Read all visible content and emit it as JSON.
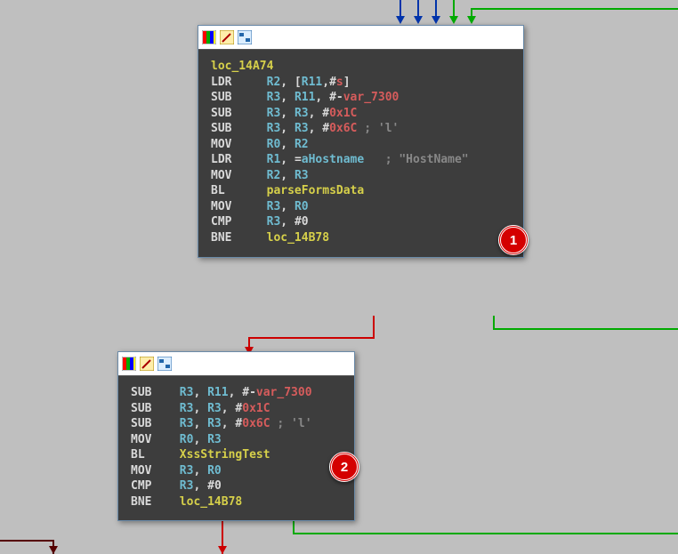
{
  "node1": {
    "label": "loc_14A74",
    "lines": [
      {
        "mn": "LDR",
        "args": [
          [
            "reg",
            "R2"
          ],
          [
            "plain",
            ", ["
          ],
          [
            "reg",
            "R11"
          ],
          [
            "plain",
            ",#"
          ],
          [
            "var",
            "s"
          ],
          [
            "plain",
            "]"
          ]
        ]
      },
      {
        "mn": "SUB",
        "args": [
          [
            "reg",
            "R3"
          ],
          [
            "plain",
            ", "
          ],
          [
            "reg",
            "R11"
          ],
          [
            "plain",
            ", "
          ],
          [
            "hash",
            "#-"
          ],
          [
            "var",
            "var_7300"
          ]
        ]
      },
      {
        "mn": "SUB",
        "args": [
          [
            "reg",
            "R3"
          ],
          [
            "plain",
            ", "
          ],
          [
            "reg",
            "R3"
          ],
          [
            "plain",
            ", "
          ],
          [
            "hash",
            "#"
          ],
          [
            "hex",
            "0x1C"
          ]
        ]
      },
      {
        "mn": "SUB",
        "args": [
          [
            "reg",
            "R3"
          ],
          [
            "plain",
            ", "
          ],
          [
            "reg",
            "R3"
          ],
          [
            "plain",
            ", "
          ],
          [
            "hash",
            "#"
          ],
          [
            "hex",
            "0x6C"
          ],
          [
            "cmt",
            " ; 'l'"
          ]
        ]
      },
      {
        "mn": "MOV",
        "args": [
          [
            "reg",
            "R0"
          ],
          [
            "plain",
            ", "
          ],
          [
            "reg",
            "R2"
          ]
        ]
      },
      {
        "mn": "LDR",
        "args": [
          [
            "reg",
            "R1"
          ],
          [
            "plain",
            ", "
          ],
          [
            "eq",
            "="
          ],
          [
            "str",
            "aHostname"
          ],
          [
            "cmt",
            "   ; \"HostName\""
          ]
        ]
      },
      {
        "mn": "MOV",
        "args": [
          [
            "reg",
            "R2"
          ],
          [
            "plain",
            ", "
          ],
          [
            "reg",
            "R3"
          ]
        ]
      },
      {
        "mn": "BL",
        "args": [
          [
            "call",
            "parseFormsData"
          ]
        ]
      },
      {
        "mn": "MOV",
        "args": [
          [
            "reg",
            "R3"
          ],
          [
            "plain",
            ", "
          ],
          [
            "reg",
            "R0"
          ]
        ]
      },
      {
        "mn": "CMP",
        "args": [
          [
            "reg",
            "R3"
          ],
          [
            "plain",
            ", "
          ],
          [
            "hash",
            "#"
          ],
          [
            "num",
            "0"
          ]
        ]
      },
      {
        "mn": "BNE",
        "args": [
          [
            "call",
            "loc_14B78"
          ]
        ]
      }
    ],
    "badge": "1"
  },
  "node2": {
    "lines": [
      {
        "mn": "SUB",
        "args": [
          [
            "reg",
            "R3"
          ],
          [
            "plain",
            ", "
          ],
          [
            "reg",
            "R11"
          ],
          [
            "plain",
            ", "
          ],
          [
            "hash",
            "#-"
          ],
          [
            "var",
            "var_7300"
          ]
        ]
      },
      {
        "mn": "SUB",
        "args": [
          [
            "reg",
            "R3"
          ],
          [
            "plain",
            ", "
          ],
          [
            "reg",
            "R3"
          ],
          [
            "plain",
            ", "
          ],
          [
            "hash",
            "#"
          ],
          [
            "hex",
            "0x1C"
          ]
        ]
      },
      {
        "mn": "SUB",
        "args": [
          [
            "reg",
            "R3"
          ],
          [
            "plain",
            ", "
          ],
          [
            "reg",
            "R3"
          ],
          [
            "plain",
            ", "
          ],
          [
            "hash",
            "#"
          ],
          [
            "hex",
            "0x6C"
          ],
          [
            "cmt",
            " ; 'l'"
          ]
        ]
      },
      {
        "mn": "MOV",
        "args": [
          [
            "reg",
            "R0"
          ],
          [
            "plain",
            ", "
          ],
          [
            "reg",
            "R3"
          ]
        ]
      },
      {
        "mn": "BL",
        "args": [
          [
            "call",
            "XssStringTest"
          ]
        ]
      },
      {
        "mn": "MOV",
        "args": [
          [
            "reg",
            "R3"
          ],
          [
            "plain",
            ", "
          ],
          [
            "reg",
            "R0"
          ]
        ]
      },
      {
        "mn": "CMP",
        "args": [
          [
            "reg",
            "R3"
          ],
          [
            "plain",
            ", "
          ],
          [
            "hash",
            "#"
          ],
          [
            "num",
            "0"
          ]
        ]
      },
      {
        "mn": "BNE",
        "args": [
          [
            "call",
            "loc_14B78"
          ]
        ]
      }
    ],
    "badge": "2"
  }
}
